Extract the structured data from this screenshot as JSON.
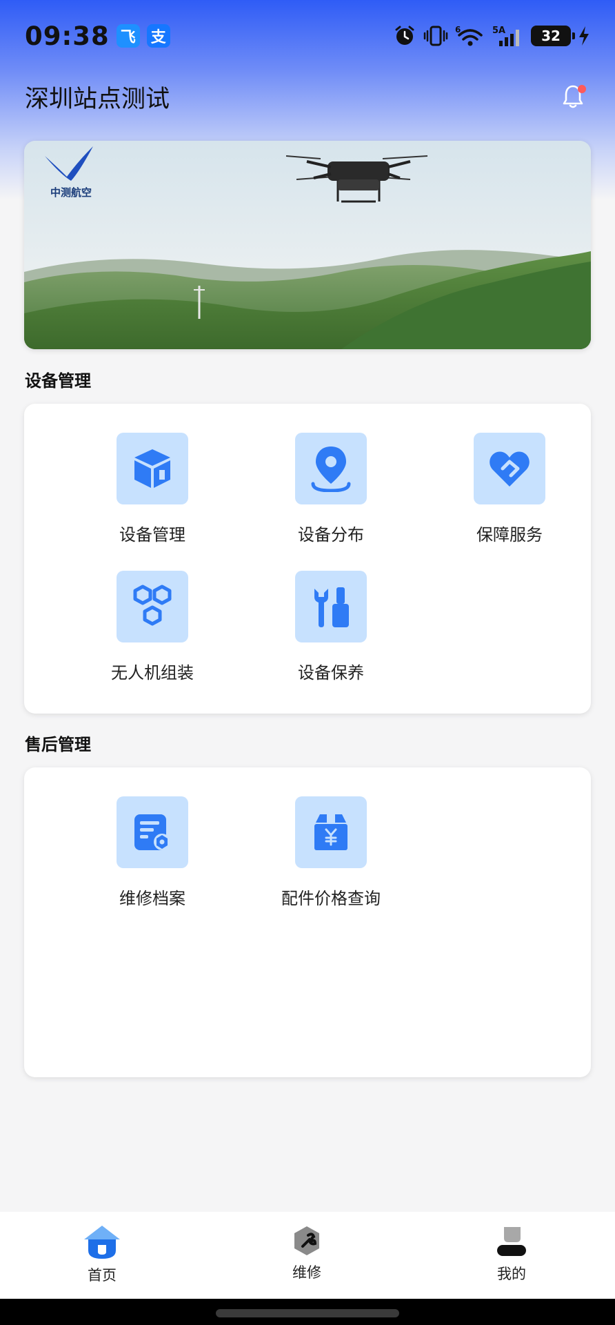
{
  "status_bar": {
    "time": "09:38",
    "app_badges": [
      "飞",
      "支"
    ],
    "network": "5A",
    "wifi_label": "6",
    "battery": "32"
  },
  "header": {
    "title": "深圳站点测试"
  },
  "banner": {
    "logo_text": "中测航空"
  },
  "device_section": {
    "title": "设备管理",
    "items": [
      {
        "label": "设备管理",
        "icon": "box-icon"
      },
      {
        "label": "设备分布",
        "icon": "location-pin-icon"
      },
      {
        "label": "保障服务",
        "icon": "heart-handshake-icon"
      },
      {
        "label": "无人机组装",
        "icon": "hexagon-cluster-icon"
      },
      {
        "label": "设备保养",
        "icon": "wrench-screwdriver-icon"
      }
    ]
  },
  "aftersales_section": {
    "title": "售后管理",
    "items": [
      {
        "label": "维修档案",
        "icon": "document-gear-icon"
      },
      {
        "label": "配件价格查询",
        "icon": "yuan-box-icon"
      }
    ]
  },
  "bottom_nav": {
    "items": [
      {
        "label": "首页",
        "icon": "home-icon",
        "active": true
      },
      {
        "label": "维修",
        "icon": "repair-icon",
        "active": false
      },
      {
        "label": "我的",
        "icon": "profile-icon",
        "active": false
      }
    ]
  },
  "colors": {
    "accent": "#2f7bf5",
    "tile_bg": "#c7e1fe",
    "header_gradient_top": "#2f5cf6",
    "notification_dot": "#ff5a5a"
  }
}
